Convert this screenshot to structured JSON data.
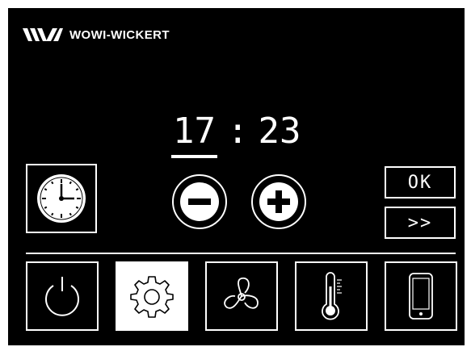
{
  "header": {
    "brand": "WOWI-WICKERT",
    "logo_icon": "wowi-wickert-logo-icon"
  },
  "clock": {
    "hours": "17",
    "separator": ":",
    "minutes": "23"
  },
  "controls": {
    "clock_icon": "clock-icon",
    "minus_icon": "minus-icon",
    "plus_icon": "plus-icon",
    "ok_label": "OK",
    "next_label": ">>"
  },
  "bottom_bar": {
    "items": [
      {
        "name": "power",
        "icon": "power-icon",
        "active": false
      },
      {
        "name": "settings",
        "icon": "gear-icon",
        "active": true
      },
      {
        "name": "fan",
        "icon": "fan-icon",
        "active": false
      },
      {
        "name": "temperature",
        "icon": "thermometer-icon",
        "active": false
      },
      {
        "name": "phone",
        "icon": "smartphone-icon",
        "active": false
      }
    ]
  },
  "colors": {
    "background": "#000000",
    "foreground": "#ffffff"
  }
}
